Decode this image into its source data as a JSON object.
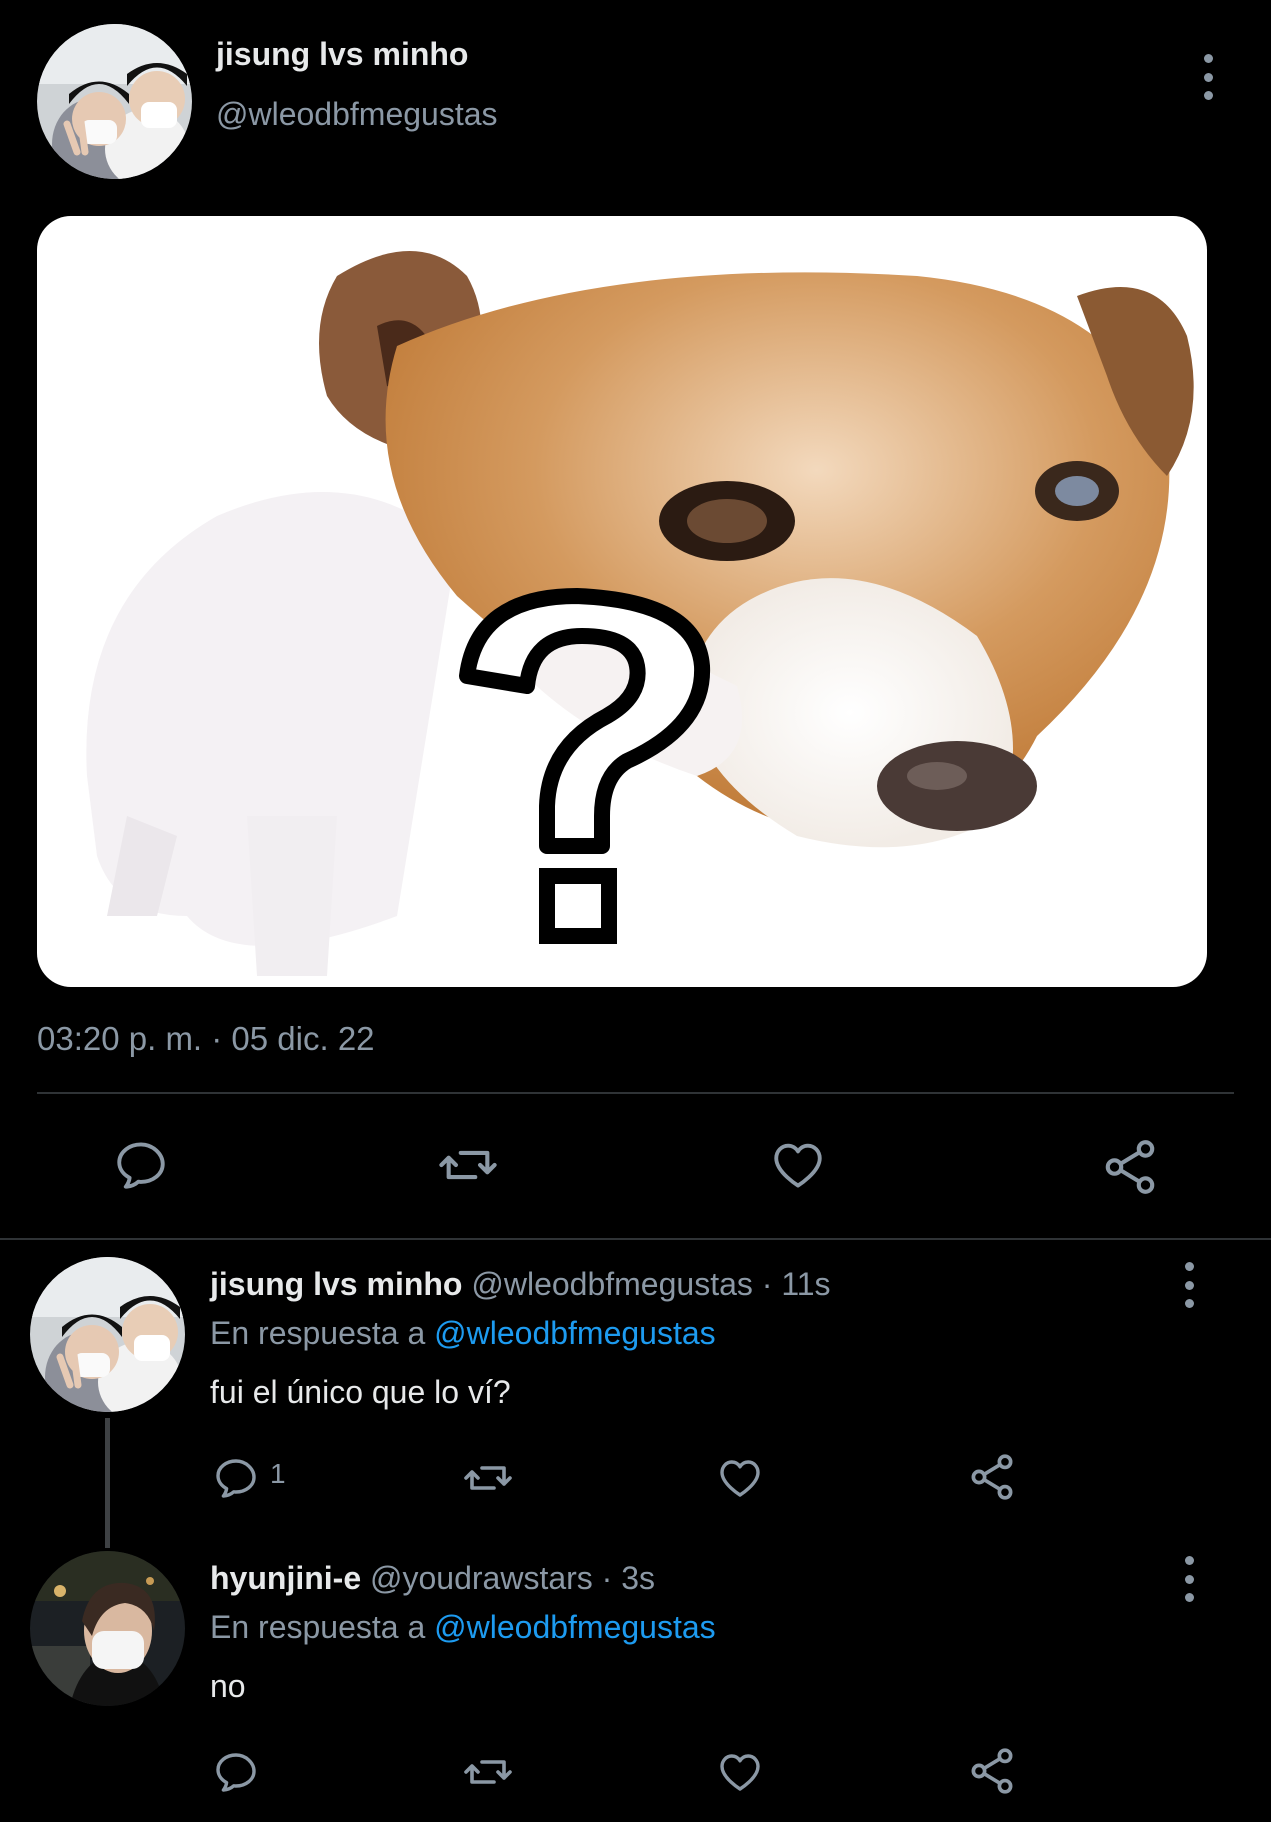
{
  "main_tweet": {
    "display_name": "jisung lvs minho",
    "handle": "@wleodbfmegustas",
    "timestamp": "03:20 p. m. · 05 dic. 22",
    "image_alt": "perro con signo de interrogación"
  },
  "replies": [
    {
      "display_name": "jisung lvs minho",
      "handle": "@wleodbfmegustas",
      "age": "· 11s",
      "reply_prefix": "En respuesta a",
      "reply_to": "@wleodbfmegustas",
      "text": "fui el único que lo ví?",
      "reply_count": "1"
    },
    {
      "display_name": "hyunjini-e",
      "handle": "@youdrawstars",
      "age": "· 3s",
      "reply_prefix": "En respuesta a",
      "reply_to": "@wleodbfmegustas",
      "text": "no",
      "reply_count": ""
    }
  ],
  "icons": [
    "more-icon",
    "reply-icon",
    "retweet-icon",
    "like-icon",
    "share-icon"
  ],
  "colors": {
    "background": "#000000",
    "text": "#e7e9ea",
    "secondary": "#8b98a5",
    "link": "#1d9bf0",
    "divider": "#2f3336"
  }
}
